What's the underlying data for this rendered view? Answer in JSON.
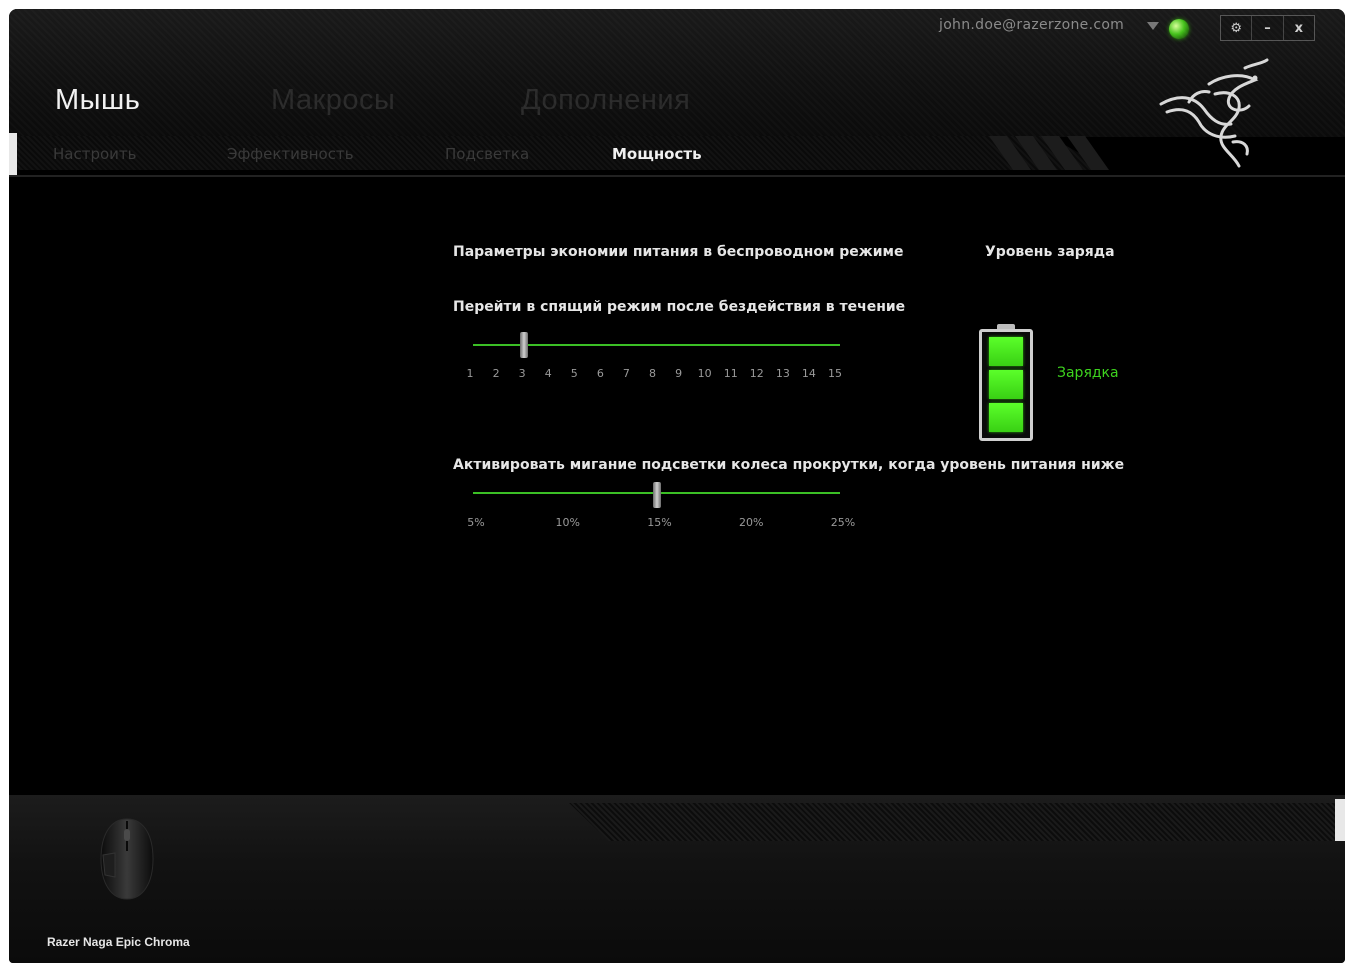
{
  "header": {
    "user_email": "john.doe@razerzone.com",
    "window_controls": [
      "⚙",
      "–",
      "x"
    ],
    "main_tabs": [
      {
        "label": "Мышь",
        "active": true
      },
      {
        "label": "Макросы",
        "active": false
      },
      {
        "label": "Дополнения",
        "active": false
      }
    ],
    "logo_icon": "razer-snake-logo-icon"
  },
  "sub_tabs": [
    {
      "label": "Настроить",
      "active": false
    },
    {
      "label": "Эффективность",
      "active": false
    },
    {
      "label": "Подсветка",
      "active": false
    },
    {
      "label": "Мощность",
      "active": true
    }
  ],
  "power": {
    "section_title": "Параметры экономии питания в беспроводном режиме",
    "sleep_label": "Перейти в спящий режим после бездействия в течение",
    "sleep_ticks": [
      "1",
      "2",
      "3",
      "4",
      "5",
      "6",
      "7",
      "8",
      "9",
      "10",
      "11",
      "12",
      "13",
      "14",
      "15"
    ],
    "sleep_value": 3,
    "low_power_label": "Активировать мигание подсветки колеса прокрутки, когда уровень питания ниже",
    "low_power_ticks": [
      "5%",
      "10%",
      "15%",
      "20%",
      "25%"
    ],
    "low_power_value": "15%",
    "battery_title": "Уровень заряда",
    "battery_status": "Зарядка",
    "battery_color": "#3dd21e"
  },
  "footer": {
    "device_name": "Razer Naga Epic Chroma"
  }
}
